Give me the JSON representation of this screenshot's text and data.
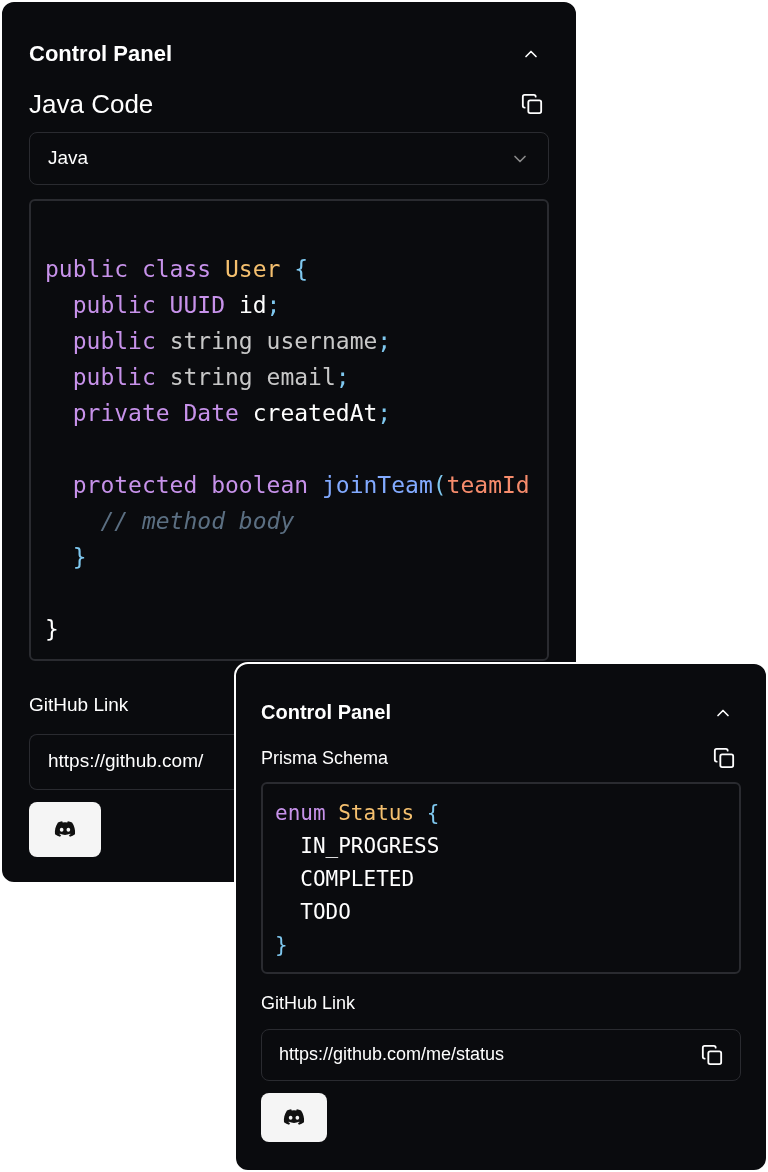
{
  "panels": [
    {
      "title": "Control Panel",
      "expanded": true,
      "code_title": "Java Code",
      "language": "Java",
      "code": [
        {
          "kind": "blank"
        },
        {
          "kind": "code",
          "tokens": [
            {
              "kind": "keyword",
              "text": "public class "
            },
            {
              "kind": "class",
              "text": "User "
            },
            {
              "kind": "punct",
              "text": "{"
            }
          ]
        },
        {
          "kind": "code",
          "tokens": [
            {
              "kind": "keyword",
              "text": "  public UUID "
            },
            {
              "kind": "ident",
              "text": "id"
            },
            {
              "kind": "punct",
              "text": ";"
            }
          ]
        },
        {
          "kind": "code",
          "tokens": [
            {
              "kind": "keyword",
              "text": "  public "
            },
            {
              "kind": "builtin",
              "text": "string username"
            },
            {
              "kind": "punct",
              "text": ";"
            }
          ]
        },
        {
          "kind": "code",
          "tokens": [
            {
              "kind": "keyword",
              "text": "  public "
            },
            {
              "kind": "builtin",
              "text": "string email"
            },
            {
              "kind": "punct",
              "text": ";"
            }
          ]
        },
        {
          "kind": "code",
          "tokens": [
            {
              "kind": "keyword",
              "text": "  private Date "
            },
            {
              "kind": "ident",
              "text": "createdAt"
            },
            {
              "kind": "punct",
              "text": ";"
            }
          ]
        },
        {
          "kind": "blank"
        },
        {
          "kind": "code",
          "tokens": [
            {
              "kind": "keyword",
              "text": "  protected boolean "
            },
            {
              "kind": "func",
              "text": "joinTeam"
            },
            {
              "kind": "punct",
              "text": "("
            },
            {
              "kind": "param",
              "text": "teamId"
            }
          ]
        },
        {
          "kind": "code",
          "tokens": [
            {
              "kind": "comment",
              "text": "    // method body"
            }
          ]
        },
        {
          "kind": "code",
          "tokens": [
            {
              "kind": "punct",
              "text": "  }"
            }
          ]
        },
        {
          "kind": "blank"
        },
        {
          "kind": "code",
          "tokens": [
            {
              "kind": "ident",
              "text": "}"
            }
          ]
        }
      ],
      "link_label": "GitHub Link",
      "link": "https://github.com/",
      "link_copyable": false
    },
    {
      "title": "Control Panel",
      "expanded": true,
      "code_title": "Prisma Schema",
      "code": [
        {
          "kind": "code",
          "tokens": [
            {
              "kind": "keyword",
              "text": "enum "
            },
            {
              "kind": "class",
              "text": "Status "
            },
            {
              "kind": "punct",
              "text": "{"
            }
          ]
        },
        {
          "kind": "code",
          "tokens": [
            {
              "kind": "ident",
              "text": "  IN_PROGRESS"
            }
          ]
        },
        {
          "kind": "code",
          "tokens": [
            {
              "kind": "ident",
              "text": "  COMPLETED"
            }
          ]
        },
        {
          "kind": "code",
          "tokens": [
            {
              "kind": "ident",
              "text": "  TODO"
            }
          ]
        },
        {
          "kind": "code",
          "tokens": [
            {
              "kind": "punct",
              "text": "}"
            }
          ]
        }
      ],
      "link_label": "GitHub Link",
      "link": "https://github.com/me/status",
      "link_copyable": true
    }
  ]
}
